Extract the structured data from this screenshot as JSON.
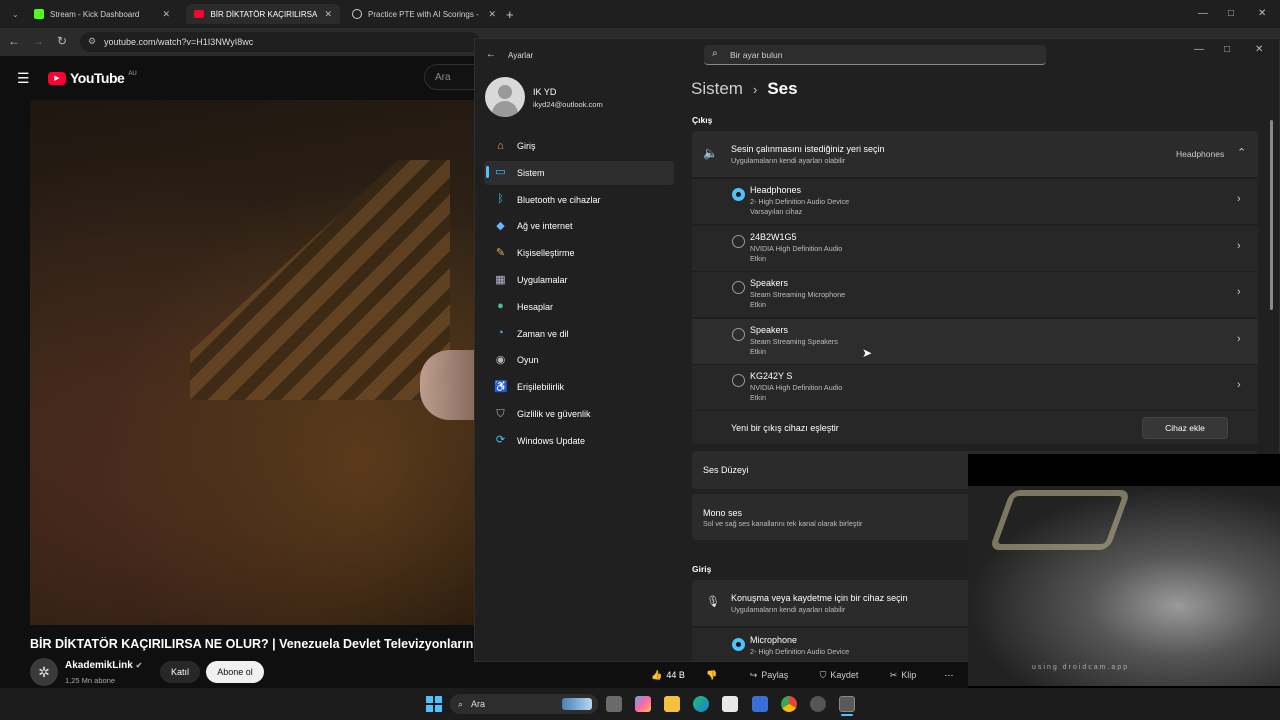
{
  "browser": {
    "tabs": [
      {
        "label": "Stream - Kick Dashboard",
        "active": false,
        "icon": "kick-icon",
        "color": "#53fc18"
      },
      {
        "label": "BİR DİKTATÖR KAÇIRILIRSA NE",
        "active": true,
        "icon": "youtube-icon",
        "color": "#ff0033"
      },
      {
        "label": "Practice PTE with AI Scorings -",
        "active": false,
        "icon": "globe-icon",
        "color": "#cccccc"
      }
    ],
    "url": "youtube.com/watch?v=H1I3NWyI8wc"
  },
  "youtube": {
    "logo_text": "YouTube",
    "region": "AU",
    "search_placeholder": "Ara",
    "video_title": "BİR DİKTATÖR KAÇIRILIRSA NE OLUR? | Venezuela Devlet Televizyonların",
    "channel_name": "AkademikLink",
    "subscribers": "1,25 Mn abone",
    "join_label": "Katıl",
    "subscribe_label": "Abone ol",
    "likes": "44 B",
    "share_label": "Paylaş",
    "save_label": "Kaydet",
    "clip_label": "Klip",
    "more_label": "⋯"
  },
  "settings": {
    "app_title": "Ayarlar",
    "search_placeholder": "Bir ayar bulun",
    "user_name": "IK YD",
    "user_email": "ikyd24@outlook.com",
    "nav": [
      {
        "label": "Giriş",
        "icon": "home-icon",
        "glyph": "⌂",
        "color": "#f7a440"
      },
      {
        "label": "Sistem",
        "icon": "system-icon",
        "glyph": "▭",
        "color": "#4cc2ff",
        "selected": true
      },
      {
        "label": "Bluetooth ve cihazlar",
        "icon": "bluetooth-icon",
        "glyph": "ᛒ",
        "color": "#4cc2ff"
      },
      {
        "label": "Ağ ve internet",
        "icon": "wifi-icon",
        "glyph": "◆",
        "color": "#6ab4ff"
      },
      {
        "label": "Kişiselleştirme",
        "icon": "brush-icon",
        "glyph": "✎",
        "color": "#e8b04a"
      },
      {
        "label": "Uygulamalar",
        "icon": "apps-icon",
        "glyph": "▦",
        "color": "#b8b8d8"
      },
      {
        "label": "Hesaplar",
        "icon": "accounts-icon",
        "glyph": "●",
        "color": "#3fc58a"
      },
      {
        "label": "Zaman ve dil",
        "icon": "clock-globe-icon",
        "glyph": "◔",
        "color": "#4cc2ff"
      },
      {
        "label": "Oyun",
        "icon": "gamepad-icon",
        "glyph": "◉",
        "color": "#b8b8b8"
      },
      {
        "label": "Erişilebilirlik",
        "icon": "accessibility-icon",
        "glyph": "♿",
        "color": "#4cc2ff"
      },
      {
        "label": "Gizlilik ve güvenlik",
        "icon": "shield-icon",
        "glyph": "⛉",
        "color": "#b8b8b8"
      },
      {
        "label": "Windows Update",
        "icon": "update-icon",
        "glyph": "⟳",
        "color": "#4cc2ff"
      }
    ],
    "breadcrumb_parent": "Sistem",
    "breadcrumb_sep": "›",
    "breadcrumb_current": "Ses",
    "output_section": "Çıkış",
    "output_title": "Sesin çalınmasını istediğiniz yeri seçin",
    "output_subtitle": "Uygulamaların kendi ayarları olabilir",
    "output_selected": "Headphones",
    "devices": [
      {
        "name": "Headphones",
        "line1": "2- High Definition Audio Device",
        "line2": "Varsayılan cihaz",
        "selected": true
      },
      {
        "name": "24B2W1G5",
        "line1": "NVIDIA High Definition Audio",
        "line2": "Etkin",
        "selected": false
      },
      {
        "name": "Speakers",
        "line1": "Steam Streaming Microphone",
        "line2": "Etkin",
        "selected": false
      },
      {
        "name": "Speakers",
        "line1": "Steam Streaming Speakers",
        "line2": "Etkin",
        "selected": false
      },
      {
        "name": "KG242Y S",
        "line1": "NVIDIA High Definition Audio",
        "line2": "Etkin",
        "selected": false
      }
    ],
    "pair_label": "Yeni bir çıkış cihazı eşleştir",
    "add_device_label": "Cihaz ekle",
    "volume_label": "Ses Düzeyi",
    "mono_title": "Mono ses",
    "mono_subtitle": "Sol ve sağ ses kanallarını tek kanal olarak birleştir",
    "input_section": "Giriş",
    "input_title": "Konuşma veya kaydetme için bir cihaz seçin",
    "input_subtitle": "Uygulamaların kendi ayarları olabilir",
    "input_device_name": "Microphone",
    "input_device_line1": "2- High Definition Audio Device"
  },
  "webcam": {
    "watermark": "using droidcam.app"
  },
  "taskbar": {
    "search_label": "Ara"
  }
}
